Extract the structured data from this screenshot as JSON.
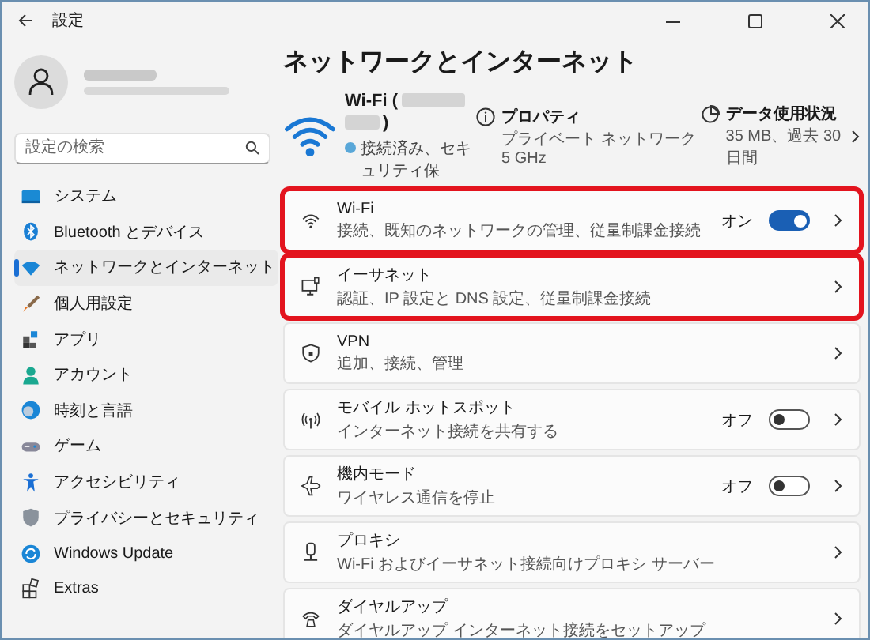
{
  "window": {
    "title": "設定"
  },
  "sidebar": {
    "search": {
      "placeholder": "設定の検索"
    },
    "items": [
      {
        "label": "システム",
        "selected": false
      },
      {
        "label": "Bluetooth とデバイス",
        "selected": false
      },
      {
        "label": "ネットワークとインターネット",
        "selected": true
      },
      {
        "label": "個人用設定",
        "selected": false
      },
      {
        "label": "アプリ",
        "selected": false
      },
      {
        "label": "アカウント",
        "selected": false
      },
      {
        "label": "時刻と言語",
        "selected": false
      },
      {
        "label": "ゲーム",
        "selected": false
      },
      {
        "label": "アクセシビリティ",
        "selected": false
      },
      {
        "label": "プライバシーとセキュリティ",
        "selected": false
      },
      {
        "label": "Windows Update",
        "selected": false
      },
      {
        "label": "Extras",
        "selected": false
      }
    ]
  },
  "page": {
    "heading": "ネットワークとインターネット",
    "summary": {
      "title_start": "Wi-Fi (",
      "title_end": ")",
      "status": "接続済み、セキュリティ保",
      "properties": {
        "title": "プロパティ",
        "lines": [
          "プライベート ネットワーク",
          "5 GHz"
        ]
      },
      "data_usage": {
        "title": "データ使用状況",
        "lines": [
          "35 MB、過去 30 日間"
        ]
      }
    },
    "cards": [
      {
        "kind": "toggle",
        "title": "Wi-Fi",
        "subtitle": "接続、既知のネットワークの管理、従量制課金接続",
        "state_label": "オン",
        "on": true,
        "highlighted": true
      },
      {
        "kind": "link",
        "title": "イーサネット",
        "subtitle": "認証、IP 設定と DNS 設定、従量制課金接続",
        "highlighted": true
      },
      {
        "kind": "link",
        "title": "VPN",
        "subtitle": "追加、接続、管理",
        "highlighted": false
      },
      {
        "kind": "toggle",
        "title": "モバイル ホットスポット",
        "subtitle": "インターネット接続を共有する",
        "state_label": "オフ",
        "on": false,
        "highlighted": false
      },
      {
        "kind": "toggle",
        "title": "機内モード",
        "subtitle": "ワイヤレス通信を停止",
        "state_label": "オフ",
        "on": false,
        "highlighted": false
      },
      {
        "kind": "link",
        "title": "プロキシ",
        "subtitle": "Wi-Fi およびイーサネット接続向けプロキシ サーバー",
        "highlighted": false
      },
      {
        "kind": "link",
        "title": "ダイヤルアップ",
        "subtitle": "ダイヤルアップ インターネット接続をセットアップ",
        "highlighted": false
      }
    ]
  }
}
